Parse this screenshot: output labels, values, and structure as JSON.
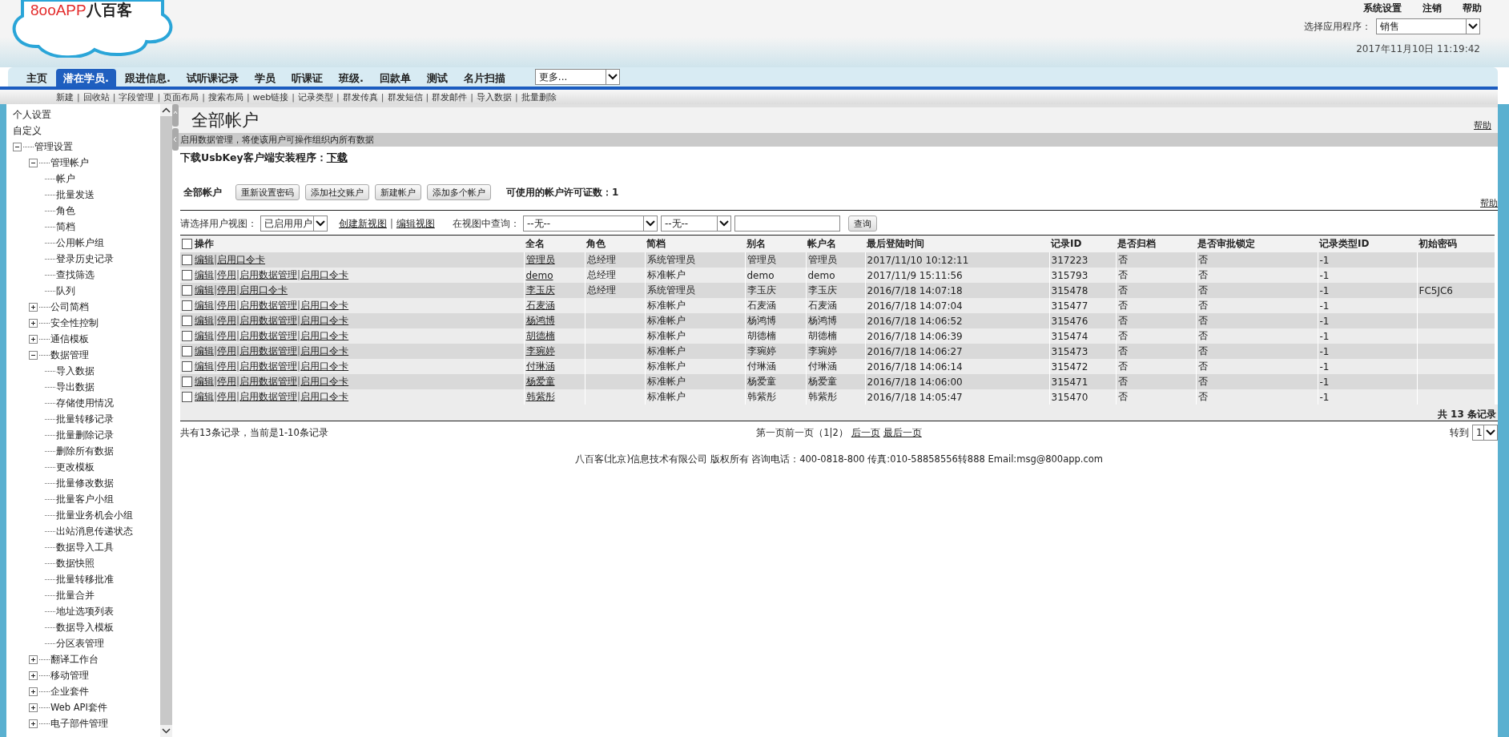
{
  "logo": {
    "latin": "8ooAPP",
    "cjk": "八百客"
  },
  "top_links": [
    "系统设置",
    "注销",
    "帮助"
  ],
  "app_select": {
    "label": "选择应用程序：",
    "value": "销售"
  },
  "datetime": "2017年11月10日 11:19:42",
  "tabs": [
    {
      "label": "主页",
      "selected": false
    },
    {
      "label": "潜在学员.",
      "selected": true
    },
    {
      "label": "跟进信息.",
      "selected": false
    },
    {
      "label": "试听课记录",
      "selected": false
    },
    {
      "label": "学员",
      "selected": false
    },
    {
      "label": "听课证",
      "selected": false
    },
    {
      "label": "班级.",
      "selected": false
    },
    {
      "label": "回款单",
      "selected": false
    },
    {
      "label": "测试",
      "selected": false
    },
    {
      "label": "名片扫描",
      "selected": false
    }
  ],
  "more_select": {
    "value": "更多..."
  },
  "subnav": {
    "separator": "|",
    "items": [
      "新建",
      "回收站",
      "字段管理",
      "页面布局",
      "搜索布局",
      "web链接",
      "记录类型",
      "群发传真",
      "群发短信",
      "群发邮件",
      "导入数据",
      "批量删除"
    ]
  },
  "sidebar": {
    "items": [
      {
        "label": "个人设置"
      },
      {
        "label": "自定义"
      },
      {
        "label": "管理设置",
        "expanded": true,
        "children": [
          {
            "label": "管理帐户",
            "expanded": true,
            "children": [
              {
                "label": "帐户"
              },
              {
                "label": "批量发送"
              },
              {
                "label": "角色"
              },
              {
                "label": "简档"
              },
              {
                "label": "公用帐户组"
              },
              {
                "label": "登录历史记录"
              },
              {
                "label": "查找筛选"
              },
              {
                "label": "队列"
              }
            ]
          },
          {
            "label": "公司简档",
            "expanded": false
          },
          {
            "label": "安全性控制",
            "expanded": false
          },
          {
            "label": "通信模板",
            "expanded": false
          },
          {
            "label": "数据管理",
            "expanded": true,
            "children": [
              {
                "label": "导入数据"
              },
              {
                "label": "导出数据"
              },
              {
                "label": "存储使用情况"
              },
              {
                "label": "批量转移记录"
              },
              {
                "label": "批量删除记录"
              },
              {
                "label": "删除所有数据"
              },
              {
                "label": "更改模板"
              },
              {
                "label": "批量修改数据"
              },
              {
                "label": "批量客户小组"
              },
              {
                "label": "批量业务机会小组"
              },
              {
                "label": "出站消息传递状态"
              },
              {
                "label": "数据导入工具"
              },
              {
                "label": "数据快照"
              },
              {
                "label": "批量转移批准"
              },
              {
                "label": "批量合并"
              },
              {
                "label": "地址选项列表"
              },
              {
                "label": "数据导入模板"
              },
              {
                "label": "分区表管理"
              }
            ]
          },
          {
            "label": "翻译工作台",
            "expanded": false
          },
          {
            "label": "移动管理",
            "expanded": false
          },
          {
            "label": "企业套件",
            "expanded": false
          },
          {
            "label": "Web API套件",
            "expanded": false
          },
          {
            "label": "电子部件管理",
            "expanded": false
          }
        ]
      }
    ]
  },
  "page": {
    "title": "全部帐户",
    "help": "帮助",
    "notice": "启用数据管理，将使该用户可操作组织内所有数据",
    "download_label": "下载UsbKey客户端安装程序：",
    "download_link": "下载"
  },
  "toolbar": {
    "title": "全部帐户",
    "buttons": [
      "重新设置密码",
      "添加社交账户",
      "新建帐户",
      "添加多个帐户"
    ],
    "license": "可使用的帐户许可证数：1",
    "help": "帮助"
  },
  "filter": {
    "label": "请选择用户视图：",
    "view": "已启用用户",
    "links": [
      "创建新视图",
      "编辑视图"
    ],
    "separator": "|",
    "search_label": "在视图中查询：",
    "field1": "--无--",
    "field2": "--无--",
    "button": "查询"
  },
  "table": {
    "action_header": "操作",
    "columns": [
      "全名",
      "角色",
      "简档",
      "别名",
      "帐户名",
      "最后登陆时间",
      "记录ID",
      "是否归档",
      "是否审批锁定",
      "记录类型ID",
      "初始密码"
    ],
    "action_separator": "|",
    "rows": [
      {
        "checked": false,
        "actions": [
          "编辑",
          "启用口令卡"
        ],
        "cells": [
          "管理员",
          "总经理",
          "系统管理员",
          "管理员",
          "管理员",
          "2017/11/10 10:12:11",
          "317223",
          "否",
          "否",
          "-1",
          null
        ]
      },
      {
        "checked": false,
        "actions": [
          "编辑",
          "停用",
          "启用数据管理",
          "启用口令卡"
        ],
        "cells": [
          "demo",
          "总经理",
          "标准帐户",
          "demo",
          "demo",
          "2017/11/9 15:11:56",
          "315793",
          "否",
          "否",
          "-1",
          null
        ]
      },
      {
        "checked": false,
        "actions": [
          "编辑",
          "停用",
          "启用口令卡"
        ],
        "cells": [
          "李玉庆",
          "总经理",
          "系统管理员",
          "李玉庆",
          "李玉庆",
          "2016/7/18 14:07:18",
          "315478",
          "否",
          "否",
          "-1",
          "FC5JC6"
        ]
      },
      {
        "checked": false,
        "actions": [
          "编辑",
          "停用",
          "启用数据管理",
          "启用口令卡"
        ],
        "cells": [
          "石麦涵",
          null,
          "标准帐户",
          "石麦涵",
          "石麦涵",
          "2016/7/18 14:07:04",
          "315477",
          "否",
          "否",
          "-1",
          null
        ]
      },
      {
        "checked": false,
        "actions": [
          "编辑",
          "停用",
          "启用数据管理",
          "启用口令卡"
        ],
        "cells": [
          "杨鸿博",
          null,
          "标准帐户",
          "杨鸿博",
          "杨鸿博",
          "2016/7/18 14:06:52",
          "315476",
          "否",
          "否",
          "-1",
          null
        ]
      },
      {
        "checked": false,
        "actions": [
          "编辑",
          "停用",
          "启用数据管理",
          "启用口令卡"
        ],
        "cells": [
          "胡德楠",
          null,
          "标准帐户",
          "胡德楠",
          "胡德楠",
          "2016/7/18 14:06:39",
          "315474",
          "否",
          "否",
          "-1",
          null
        ]
      },
      {
        "checked": false,
        "actions": [
          "编辑",
          "停用",
          "启用数据管理",
          "启用口令卡"
        ],
        "cells": [
          "李琬婷",
          null,
          "标准帐户",
          "李琬婷",
          "李琬婷",
          "2016/7/18 14:06:27",
          "315473",
          "否",
          "否",
          "-1",
          null
        ]
      },
      {
        "checked": false,
        "actions": [
          "编辑",
          "停用",
          "启用数据管理",
          "启用口令卡"
        ],
        "cells": [
          "付琳涵",
          null,
          "标准帐户",
          "付琳涵",
          "付琳涵",
          "2016/7/18 14:06:14",
          "315472",
          "否",
          "否",
          "-1",
          null
        ]
      },
      {
        "checked": false,
        "actions": [
          "编辑",
          "停用",
          "启用数据管理",
          "启用口令卡"
        ],
        "cells": [
          "杨爱童",
          null,
          "标准帐户",
          "杨爱童",
          "杨爱童",
          "2016/7/18 14:06:00",
          "315471",
          "否",
          "否",
          "-1",
          null
        ]
      },
      {
        "checked": false,
        "actions": [
          "编辑",
          "停用",
          "启用数据管理",
          "启用口令卡"
        ],
        "cells": [
          "韩紫彤",
          null,
          "标准帐户",
          "韩紫彤",
          "韩紫彤",
          "2016/7/18 14:05:47",
          "315470",
          "否",
          "否",
          "-1",
          null
        ]
      }
    ],
    "header_checked": false,
    "total": "共 13 条记录"
  },
  "pager": {
    "summary": "共有13条记录，当前是1-10条记录",
    "pages": "第一页前一页（1|2）",
    "links": [
      "后一页",
      "最后一页"
    ],
    "goto_label": "转到",
    "goto_value": "1"
  },
  "footer": "八百客(北京)信息技术有限公司 版权所有 咨询电话：400-0818-800 传真:010-58858556转888 Email:msg@800app.com"
}
